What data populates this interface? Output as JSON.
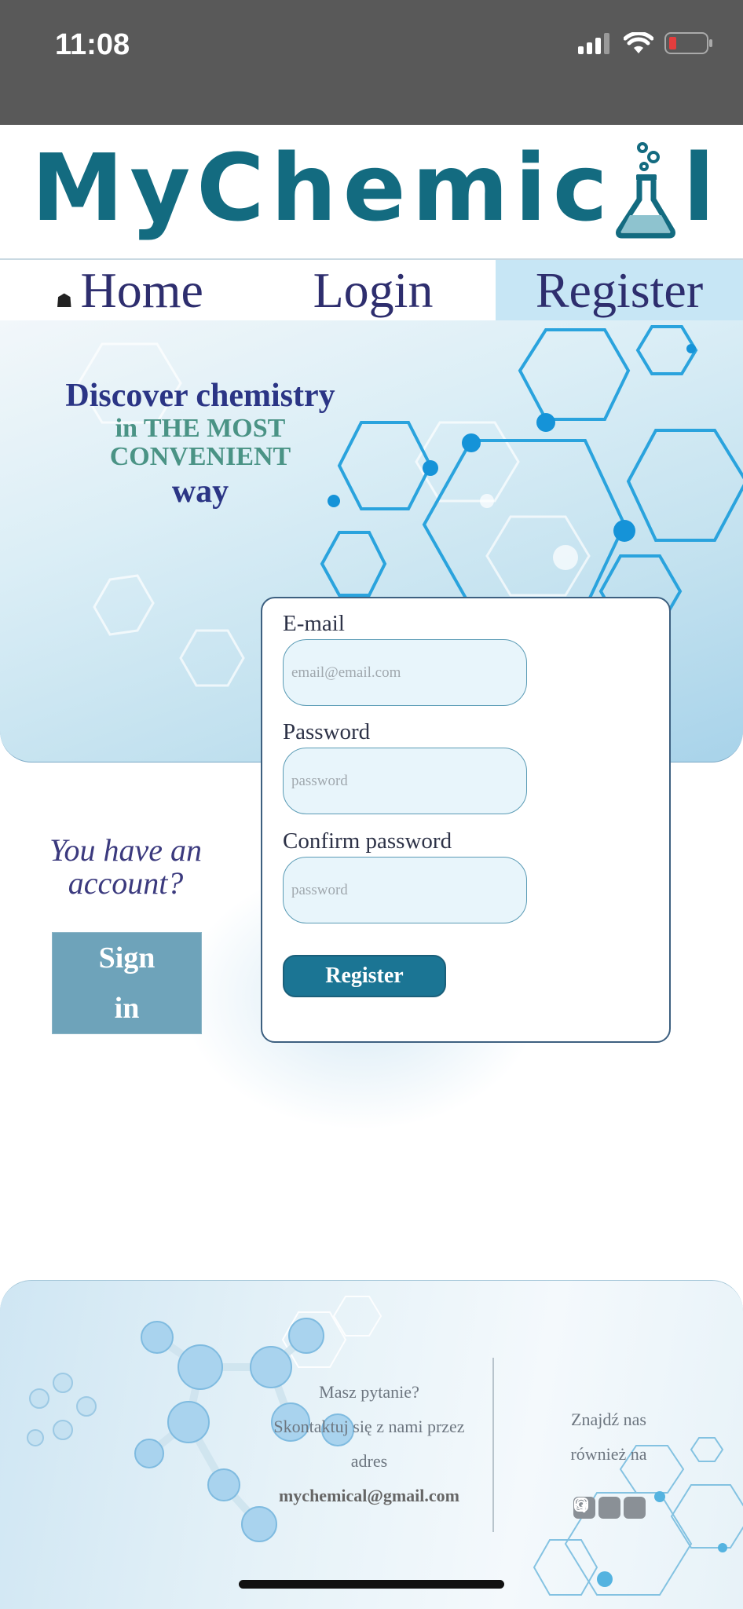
{
  "status_bar": {
    "time": "11:08"
  },
  "logo": {
    "letters": [
      "M",
      "y",
      "C",
      "h",
      "e",
      "m",
      "i",
      "c",
      "",
      "l"
    ]
  },
  "nav": {
    "home": "Home",
    "login": "Login",
    "register": "Register"
  },
  "hero": {
    "line1": "Discover chemistry",
    "line2": "in THE MOST",
    "line3": "CONVENIENT",
    "line4": "way"
  },
  "aside": {
    "question": "You have an account?",
    "signin_label": "Sign in"
  },
  "form": {
    "email_label": "E-mail",
    "email_placeholder": "email@email.com",
    "password_label": "Password",
    "password_placeholder": "password",
    "confirm_label": "Confirm password",
    "confirm_placeholder": "password",
    "submit_label": "Register"
  },
  "footer": {
    "question": "Masz pytanie?",
    "contact_line1": "Skontaktuj się z nami przez",
    "contact_line2": "adres",
    "email": "mychemical@gmail.com",
    "find_line1": "Znajdź nas",
    "find_line2": "również na",
    "social_icons": [
      "facebook-icon",
      "instagram-icon",
      "snapchat-icon"
    ]
  },
  "colors": {
    "brand": "#136b80",
    "accent": "#1b7594",
    "heading": "#2b3585"
  }
}
